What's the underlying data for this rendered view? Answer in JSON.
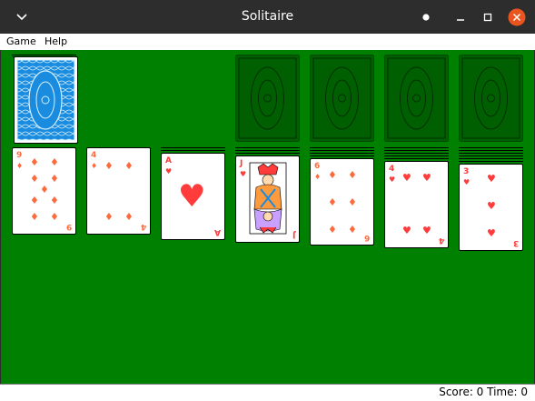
{
  "window": {
    "title": "Solitaire"
  },
  "menu": {
    "game": "Game",
    "help": "Help"
  },
  "status": {
    "text": "Score: 0 Time: 0"
  },
  "colors": {
    "felt": "#008000",
    "red": "#ff3b3b",
    "diamond": "#ff6a3d",
    "back_blue": "#1a8ce0",
    "close": "#e9541f"
  },
  "tableau": [
    {
      "rank": "9",
      "suit": "diamond",
      "hidden_below": 0
    },
    {
      "rank": "4",
      "suit": "diamond",
      "hidden_below": 0
    },
    {
      "rank": "A",
      "suit": "heart",
      "hidden_below": 2
    },
    {
      "rank": "J",
      "suit": "heart",
      "hidden_below": 3
    },
    {
      "rank": "6",
      "suit": "diamond",
      "hidden_below": 4
    },
    {
      "rank": "4",
      "suit": "heart",
      "hidden_below": 5
    },
    {
      "rank": "3",
      "suit": "heart",
      "hidden_below": 6
    }
  ]
}
